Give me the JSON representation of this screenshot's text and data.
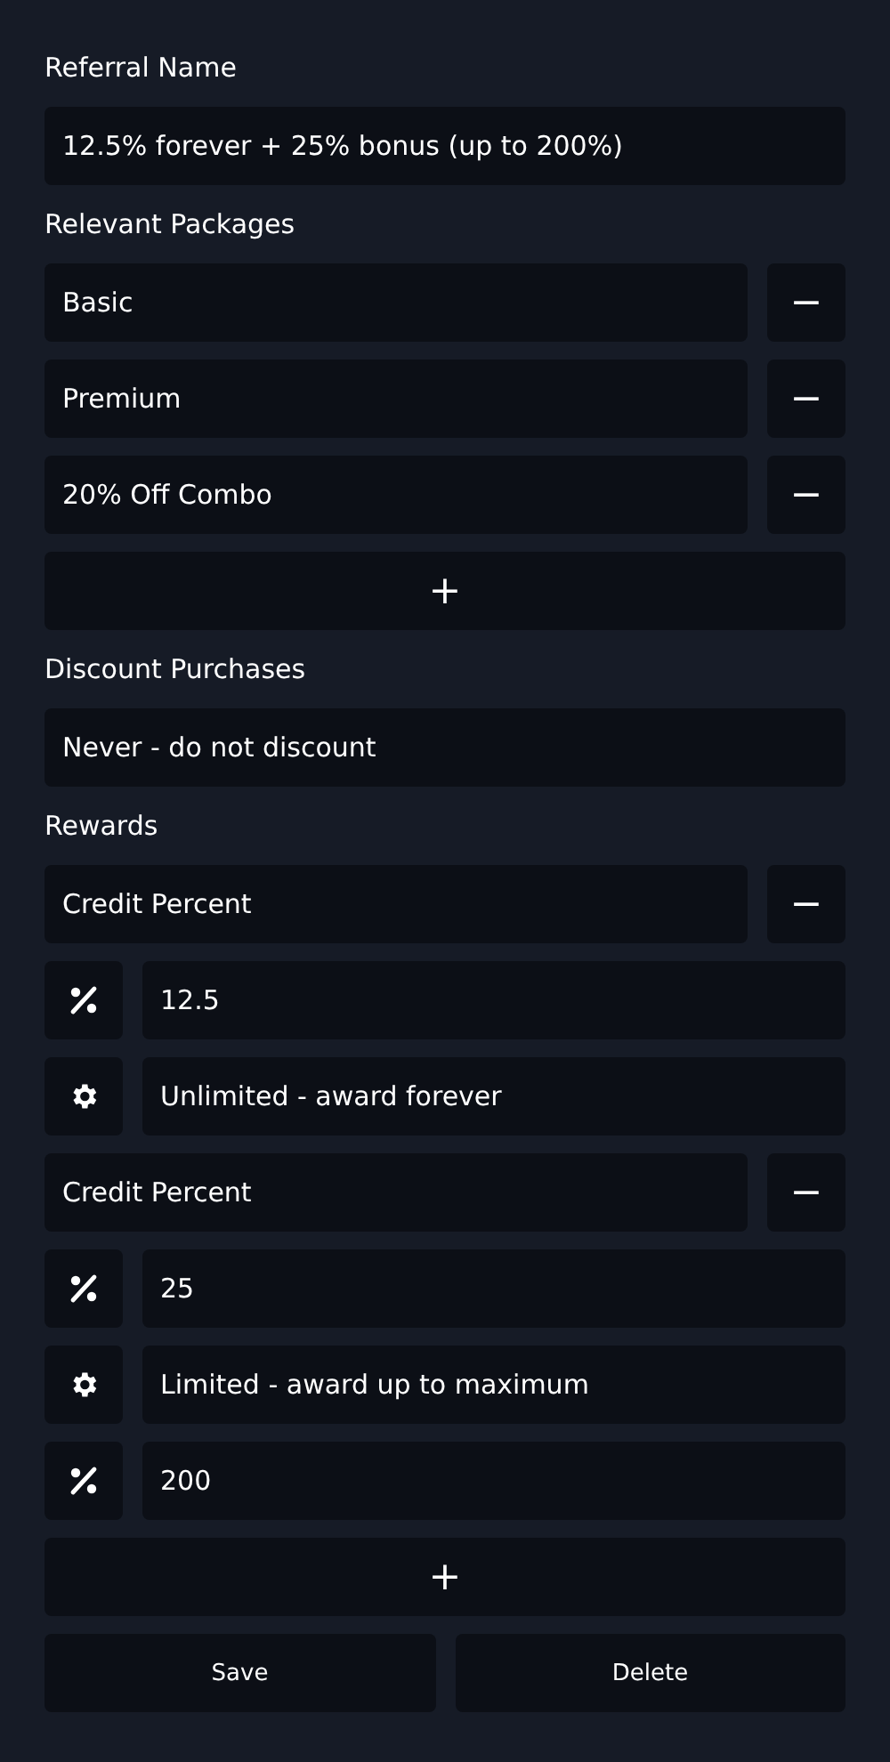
{
  "referral_name": {
    "label": "Referral Name",
    "value": "12.5% forever + 25% bonus (up to 200%)"
  },
  "relevant_packages": {
    "label": "Relevant Packages",
    "items": [
      {
        "value": "Basic",
        "remove": "−"
      },
      {
        "value": "Premium",
        "remove": "−"
      },
      {
        "value": "20% Off Combo",
        "remove": "−"
      }
    ],
    "add": "+"
  },
  "discount_purchases": {
    "label": "Discount Purchases",
    "value": "Never - do not discount"
  },
  "rewards": {
    "label": "Rewards",
    "items": [
      {
        "type": "Credit Percent",
        "remove": "−",
        "rows": [
          {
            "kind": "percent",
            "value": "12.5"
          },
          {
            "kind": "setting",
            "value": "Unlimited - award forever"
          }
        ]
      },
      {
        "type": "Credit Percent",
        "remove": "−",
        "rows": [
          {
            "kind": "percent",
            "value": "25"
          },
          {
            "kind": "setting",
            "value": "Limited - award up to maximum"
          },
          {
            "kind": "percent",
            "value": "200"
          }
        ]
      }
    ],
    "add": "+"
  },
  "buttons": [
    "Save",
    "Delete"
  ]
}
